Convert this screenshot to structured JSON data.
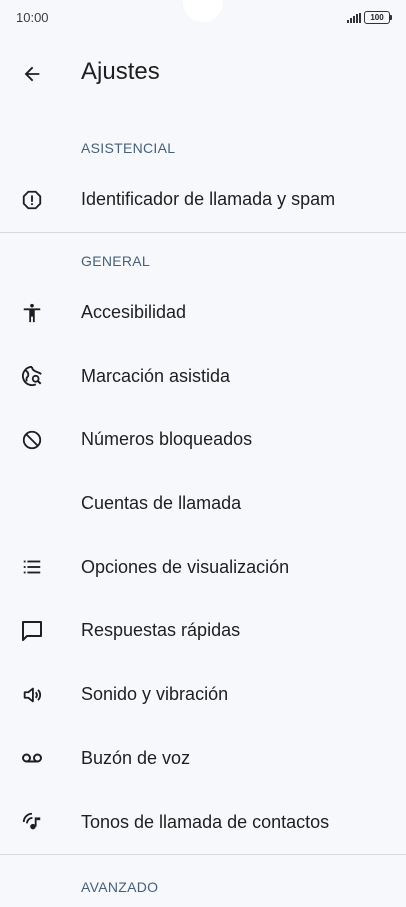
{
  "status_bar": {
    "time": "10:00",
    "battery": "100"
  },
  "app_bar": {
    "title": "Ajustes"
  },
  "sections": [
    {
      "header": "ASISTENCIAL",
      "items": [
        {
          "icon": "report-icon",
          "label": "Identificador de llamada y spam"
        }
      ]
    },
    {
      "header": "GENERAL",
      "items": [
        {
          "icon": "accessibility-icon",
          "label": "Accesibilidad"
        },
        {
          "icon": "assisted-dialing-icon",
          "label": "Marcación asistida"
        },
        {
          "icon": "block-icon",
          "label": "Números bloqueados"
        },
        {
          "icon": "",
          "label": "Cuentas de llamada"
        },
        {
          "icon": "list-icon",
          "label": "Opciones de visualización"
        },
        {
          "icon": "message-icon",
          "label": "Respuestas rápidas"
        },
        {
          "icon": "volume-icon",
          "label": "Sonido y vibración"
        },
        {
          "icon": "voicemail-icon",
          "label": "Buzón de voz"
        },
        {
          "icon": "ringtone-icon",
          "label": "Tonos de llamada de contactos"
        }
      ]
    },
    {
      "header": "AVANZADO",
      "items": []
    }
  ]
}
